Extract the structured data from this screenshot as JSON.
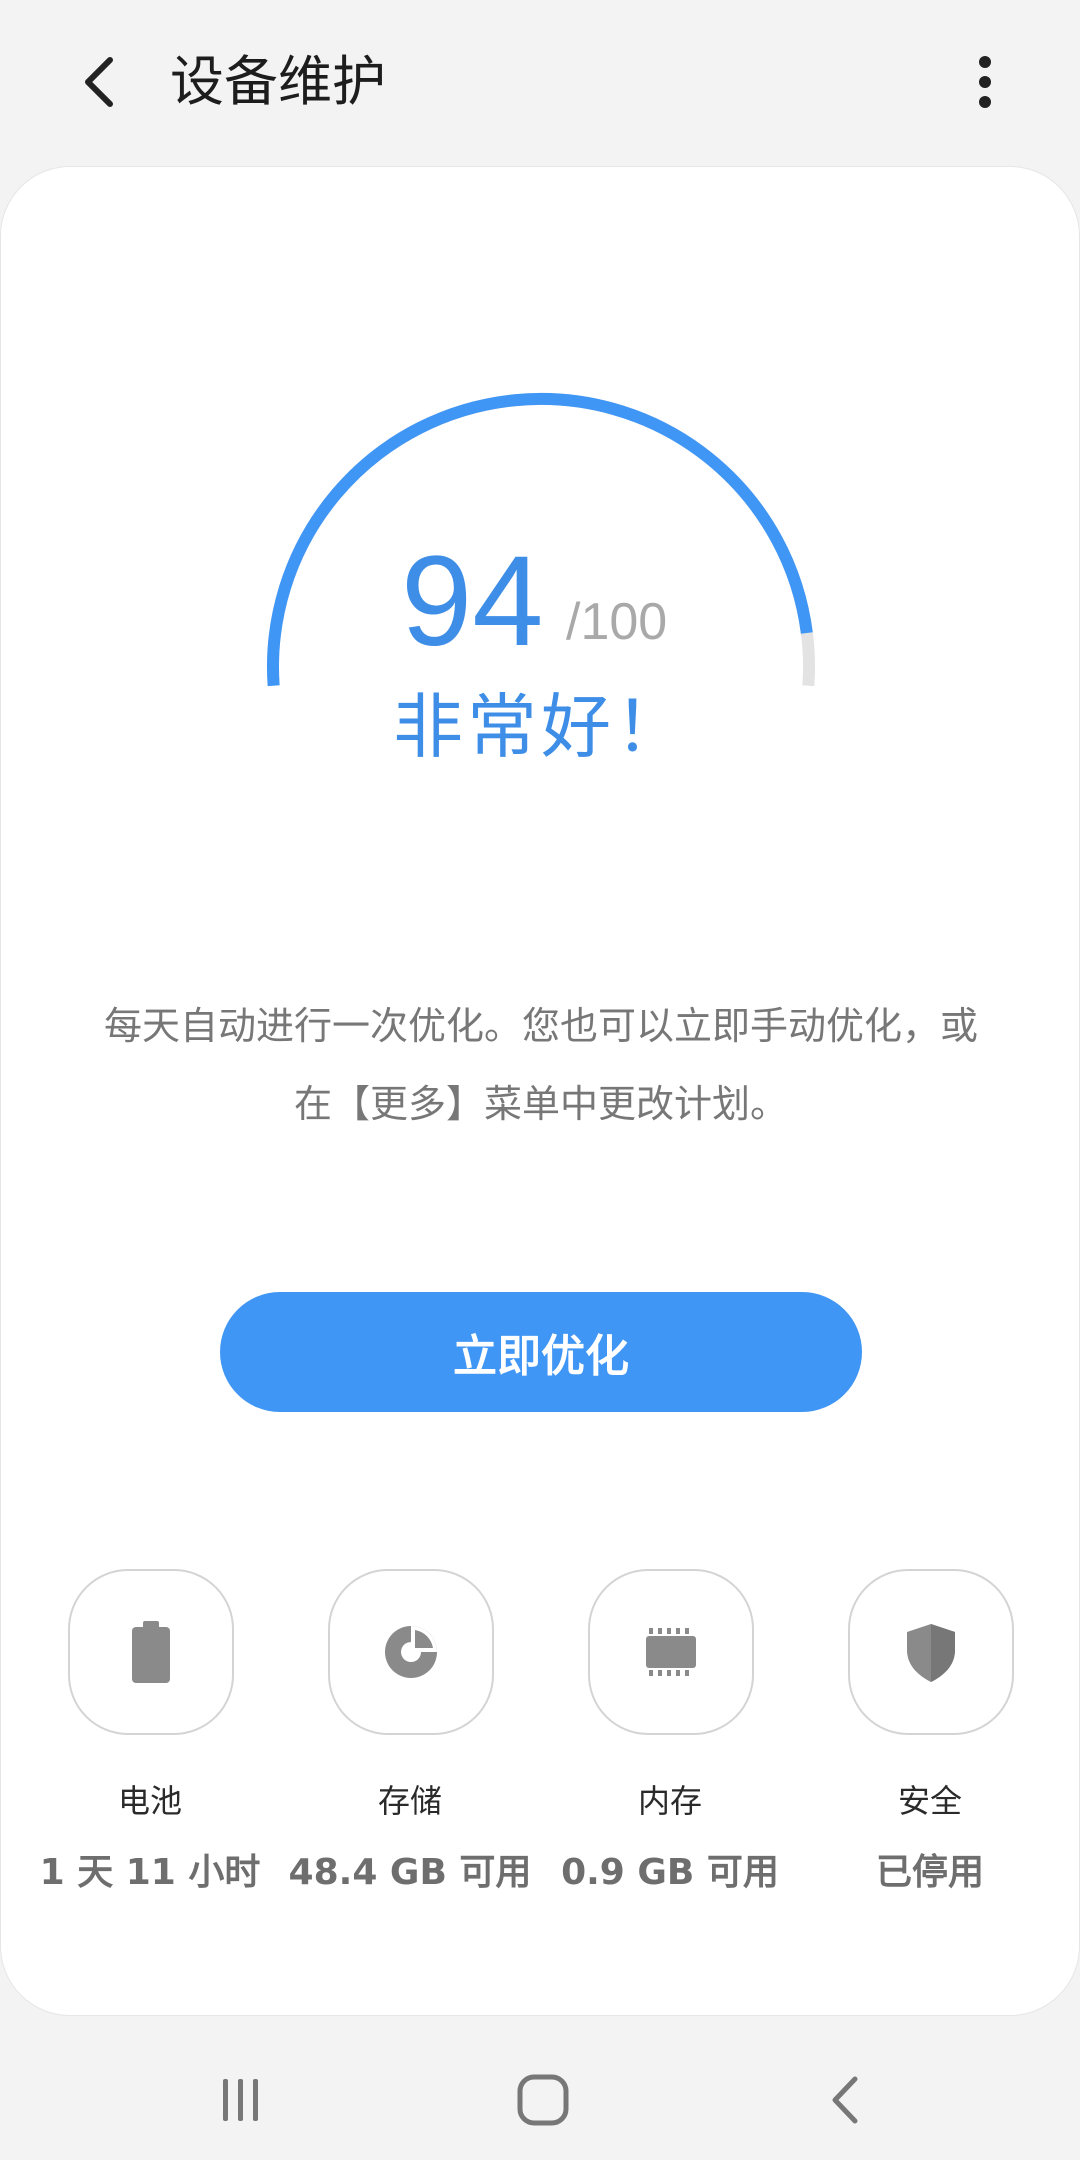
{
  "header": {
    "title": "设备维护",
    "back_icon": "chevron-left-icon",
    "more_icon": "more-vertical-icon"
  },
  "score": {
    "value": "94",
    "max": "/100",
    "status": "非常好！",
    "fraction": 0.94
  },
  "description": "每天自动进行一次优化。您也可以立即手动优化，或在【更多】菜单中更改计划。",
  "optimize_button": {
    "label": "立即优化"
  },
  "status_items": [
    {
      "label": "电池",
      "value": "1 天 11 小时",
      "icon": "battery-icon"
    },
    {
      "label": "存储",
      "value": "48.4 GB 可用",
      "icon": "storage-pie-icon"
    },
    {
      "label": "内存",
      "value": "0.9 GB 可用",
      "icon": "memory-chip-icon"
    },
    {
      "label": "安全",
      "value": "已停用",
      "icon": "shield-icon"
    }
  ],
  "colors": {
    "accent": "#4096f5",
    "score_text": "#3e8ee8",
    "track": "#e3e3e3",
    "icon_gray": "#8a8a8a"
  },
  "navbar": {
    "recents_icon": "recents-icon",
    "home_icon": "home-icon",
    "back_icon": "back-icon"
  }
}
